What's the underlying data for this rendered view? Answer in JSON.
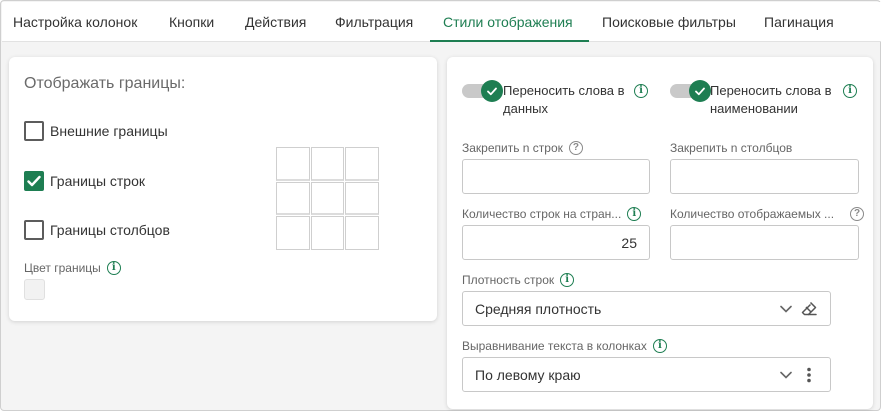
{
  "tabs": [
    {
      "label": "Настройка колонок"
    },
    {
      "label": "Кнопки"
    },
    {
      "label": "Действия"
    },
    {
      "label": "Фильтрация"
    },
    {
      "label": "Стили отображения"
    },
    {
      "label": "Поисковые фильтры"
    },
    {
      "label": "Пагинация"
    }
  ],
  "active_tab": "Стили отображения",
  "borders": {
    "title": "Отображать границы:",
    "options": [
      {
        "label": "Внешние границы",
        "checked": false
      },
      {
        "label": "Границы строк",
        "checked": true
      },
      {
        "label": "Границы столбцов",
        "checked": false
      }
    ],
    "color_label": "Цвет границы",
    "color_value": "#f2f2f2"
  },
  "toggles": [
    {
      "label_line1": "Переносить слова в",
      "label_line2": "данных",
      "on": true
    },
    {
      "label_line1": "Переносить слова в",
      "label_line2": "наименовании",
      "on": true
    }
  ],
  "fields": {
    "freeze_rows_label": "Закрепить n строк",
    "freeze_rows_value": "",
    "freeze_cols_label": "Закрепить n столбцов",
    "freeze_cols_value": "",
    "rows_per_page_label": "Количество строк на стран...",
    "rows_per_page_value": "25",
    "visible_count_label": "Количество отображаемых ...",
    "visible_count_value": "",
    "density_label": "Плотность строк",
    "density_value": "Средняя плотность",
    "align_label": "Выравнивание текста в колонках",
    "align_value": "По левому краю"
  },
  "colors": {
    "accent": "#1e7e52",
    "track": "#c9c9c9"
  },
  "icons": {
    "info": "info-icon",
    "help": "help-icon",
    "chevron": "chevron-down-icon",
    "eraser": "eraser-icon",
    "more": "more-vertical-icon"
  }
}
